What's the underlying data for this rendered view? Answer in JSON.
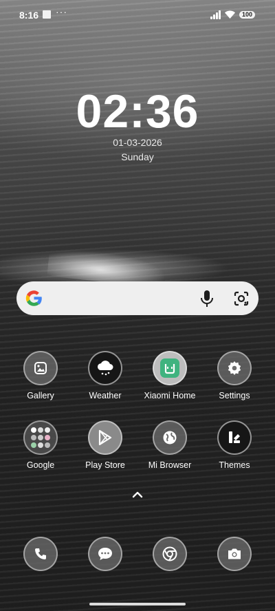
{
  "status_bar": {
    "time": "8:16",
    "battery_level": "100",
    "more_label": "···"
  },
  "clock": {
    "time": "02:36",
    "date": "01-03-2026",
    "day": "Sunday"
  },
  "search": {
    "provider_icon": "google-g-icon"
  },
  "apps": [
    {
      "label": "Gallery",
      "icon": "gallery-icon"
    },
    {
      "label": "Weather",
      "icon": "weather-icon"
    },
    {
      "label": "Xiaomi Home",
      "icon": "xiaomi-home-icon"
    },
    {
      "label": "Settings",
      "icon": "gear-icon"
    },
    {
      "label": "Google",
      "icon": "google-folder-icon"
    },
    {
      "label": "Play Store",
      "icon": "play-store-icon"
    },
    {
      "label": "Mi Browser",
      "icon": "globe-icon"
    },
    {
      "label": "Themes",
      "icon": "themes-icon"
    }
  ],
  "dock": [
    {
      "icon": "phone-icon"
    },
    {
      "icon": "messages-icon"
    },
    {
      "icon": "chrome-icon"
    },
    {
      "icon": "camera-icon"
    }
  ],
  "colors": {
    "xiaomi_home_green": "#3fb37f",
    "search_bar_bg": "#efefef"
  }
}
